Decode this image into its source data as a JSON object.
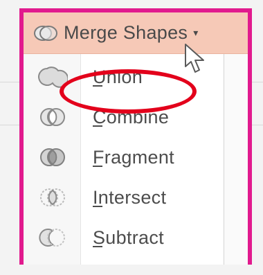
{
  "header": {
    "label": "Merge Shapes",
    "icon": "merge-shapes-icon",
    "caret": "▾"
  },
  "menu": {
    "items": [
      {
        "label": "Union",
        "icon": "union-icon",
        "highlighted": true
      },
      {
        "label": "Combine",
        "icon": "combine-icon",
        "highlighted": false
      },
      {
        "label": "Fragment",
        "icon": "fragment-icon",
        "highlighted": false
      },
      {
        "label": "Intersect",
        "icon": "intersect-icon",
        "highlighted": false
      },
      {
        "label": "Subtract",
        "icon": "subtract-icon",
        "highlighted": false
      }
    ]
  },
  "colors": {
    "frame": "#e11a8e",
    "header_bg": "#f6c9b7",
    "annotation": "#e3001b"
  }
}
